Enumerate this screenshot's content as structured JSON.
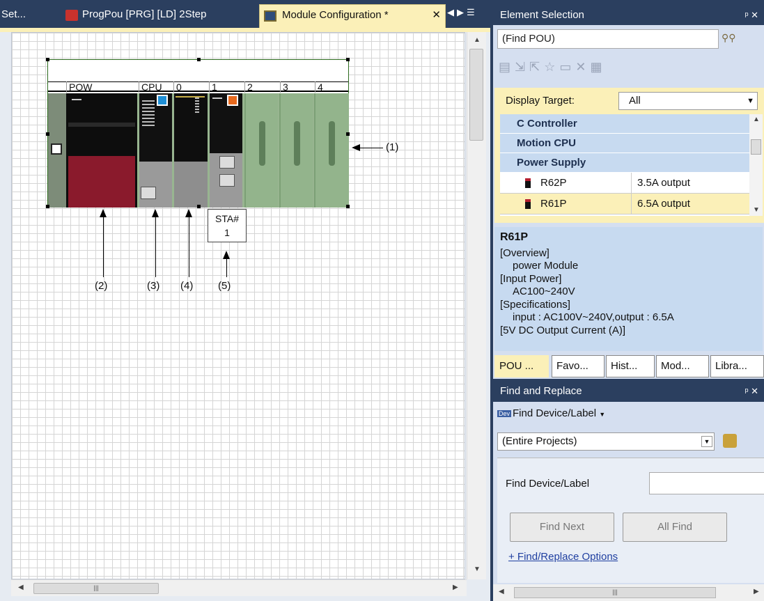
{
  "tabs": [
    {
      "label": "Set..."
    },
    {
      "label": "ProgPou [PRG] [LD] 2Step"
    },
    {
      "label": "Module Configuration *"
    }
  ],
  "module_config": {
    "slot_labels": [
      "POW",
      "CPU",
      "0",
      "1",
      "2",
      "3",
      "4"
    ],
    "sta_line1": "STA#",
    "sta_line2": "1",
    "callouts": [
      "(1)",
      "(2)",
      "(3)",
      "(4)",
      "(5)"
    ]
  },
  "element_selection": {
    "title": "Element Selection",
    "search_placeholder": "(Find POU)",
    "display_target_label": "Display Target:",
    "display_target_value": "All",
    "categories": [
      "C Controller",
      "Motion CPU",
      "Power Supply"
    ],
    "items": [
      {
        "name": "R62P",
        "desc": "3.5A output"
      },
      {
        "name": "R61P",
        "desc": "6.5A output",
        "selected": true
      }
    ],
    "detail": {
      "name": "R61P",
      "lines": [
        "[Overview]",
        "power Module",
        "[Input Power]",
        "AC100~240V",
        "[Specifications]",
        "input : AC100V~240V,output : 6.5A",
        "[5V DC Output Current (A)]"
      ]
    },
    "bottom_tabs": [
      "POU ...",
      "Favo...",
      "Hist...",
      "Mod...",
      "Libra..."
    ]
  },
  "find_replace": {
    "title": "Find and Replace",
    "mode_label": "Find Device/Label",
    "scope_value": "(Entire Projects)",
    "field_label": "Find Device/Label",
    "find_next_label": "Find Next",
    "all_find_label": "All Find",
    "options_link": "+ Find/Replace Options"
  },
  "colors": {
    "accent_tab": "#fbf0b8",
    "panel_bg": "#d5dff0",
    "category_bg": "#c7daf0",
    "title_bar": "#2b3f5f"
  }
}
